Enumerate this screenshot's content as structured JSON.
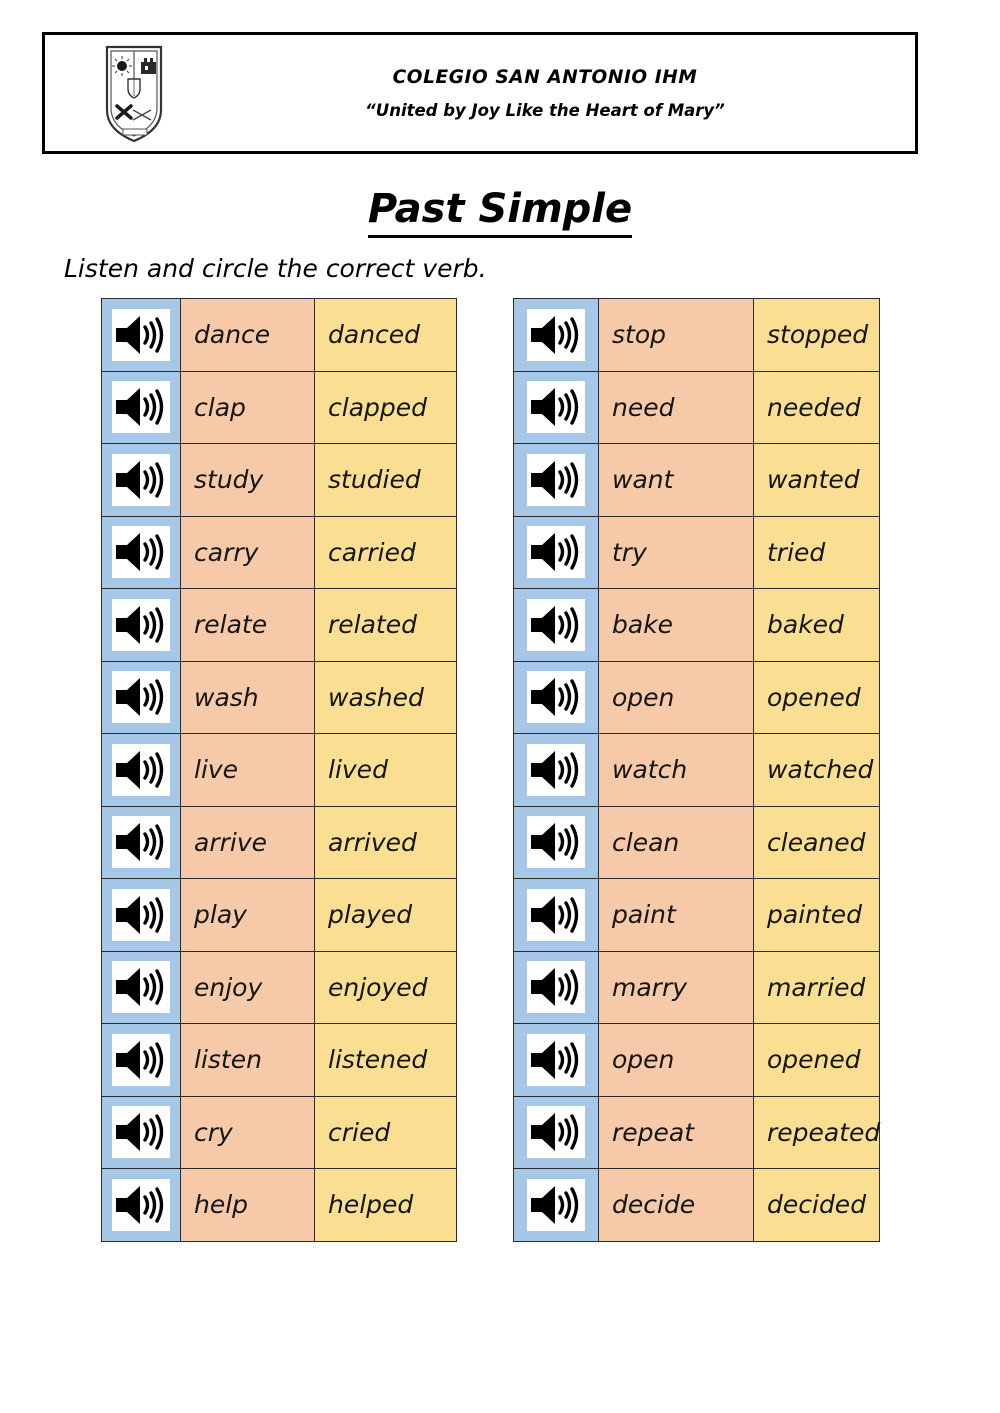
{
  "header": {
    "school_name": "COLEGIO SAN ANTONIO IHM",
    "motto": "“United by Joy Like the Heart of Mary”",
    "logo_icon": "school-crest-shield-icon"
  },
  "title": "Past Simple",
  "instruction": "Listen and circle the correct verb.",
  "colors": {
    "audio_cell": "#a7c7e8",
    "base_verb_cell": "#f6caa9",
    "past_verb_cell": "#fadf92",
    "border": "#2b2b2b",
    "text": "#151515",
    "page_background": "#ffffff"
  },
  "audio_icon_name": "speaker-sound-icon",
  "tables": [
    {
      "id": "left",
      "rows": [
        {
          "audio": "speaker-sound-icon",
          "base": "dance",
          "past": "danced"
        },
        {
          "audio": "speaker-sound-icon",
          "base": "clap",
          "past": "clapped"
        },
        {
          "audio": "speaker-sound-icon",
          "base": "study",
          "past": "studied"
        },
        {
          "audio": "speaker-sound-icon",
          "base": "carry",
          "past": "carried"
        },
        {
          "audio": "speaker-sound-icon",
          "base": "relate",
          "past": "related"
        },
        {
          "audio": "speaker-sound-icon",
          "base": "wash",
          "past": "washed"
        },
        {
          "audio": "speaker-sound-icon",
          "base": "live",
          "past": "lived"
        },
        {
          "audio": "speaker-sound-icon",
          "base": "arrive",
          "past": "arrived"
        },
        {
          "audio": "speaker-sound-icon",
          "base": "play",
          "past": "played"
        },
        {
          "audio": "speaker-sound-icon",
          "base": "enjoy",
          "past": "enjoyed"
        },
        {
          "audio": "speaker-sound-icon",
          "base": "listen",
          "past": "listened"
        },
        {
          "audio": "speaker-sound-icon",
          "base": "cry",
          "past": "cried"
        },
        {
          "audio": "speaker-sound-icon",
          "base": "help",
          "past": "helped"
        }
      ]
    },
    {
      "id": "right",
      "rows": [
        {
          "audio": "speaker-sound-icon",
          "base": "stop",
          "past": "stopped"
        },
        {
          "audio": "speaker-sound-icon",
          "base": "need",
          "past": "needed"
        },
        {
          "audio": "speaker-sound-icon",
          "base": "want",
          "past": "wanted"
        },
        {
          "audio": "speaker-sound-icon",
          "base": "try",
          "past": "tried"
        },
        {
          "audio": "speaker-sound-icon",
          "base": "bake",
          "past": "baked"
        },
        {
          "audio": "speaker-sound-icon",
          "base": "open",
          "past": "opened"
        },
        {
          "audio": "speaker-sound-icon",
          "base": "watch",
          "past": "watched"
        },
        {
          "audio": "speaker-sound-icon",
          "base": "clean",
          "past": "cleaned"
        },
        {
          "audio": "speaker-sound-icon",
          "base": "paint",
          "past": "painted"
        },
        {
          "audio": "speaker-sound-icon",
          "base": "marry",
          "past": "married"
        },
        {
          "audio": "speaker-sound-icon",
          "base": "open",
          "past": "opened"
        },
        {
          "audio": "speaker-sound-icon",
          "base": "repeat",
          "past": "repeated"
        },
        {
          "audio": "speaker-sound-icon",
          "base": "decide",
          "past": "decided"
        }
      ]
    }
  ]
}
